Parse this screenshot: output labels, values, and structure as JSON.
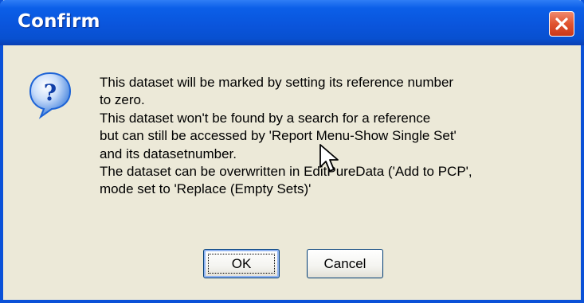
{
  "dialog": {
    "title": "Confirm",
    "message_lines": [
      "This dataset will be marked by setting its reference number",
      "to zero.",
      "This dataset won't be found by a search for a reference",
      "but can still be accessed by 'Report Menu-Show Single Set'",
      "and its datasetnumber.",
      "The dataset can be overwritten in EditPureData ('Add to PCP',",
      "mode set to 'Replace (Empty Sets)'"
    ],
    "buttons": {
      "ok_label": "OK",
      "cancel_label": "Cancel"
    },
    "icons": {
      "message_icon": "question-icon",
      "close_icon": "close-icon",
      "cursor_icon": "mouse-pointer-icon"
    }
  },
  "colors": {
    "titlebar": "#0a55dc",
    "dialog_body": "#ece9d8",
    "close_button": "#e1532f",
    "question_icon": "#1d63d6"
  }
}
